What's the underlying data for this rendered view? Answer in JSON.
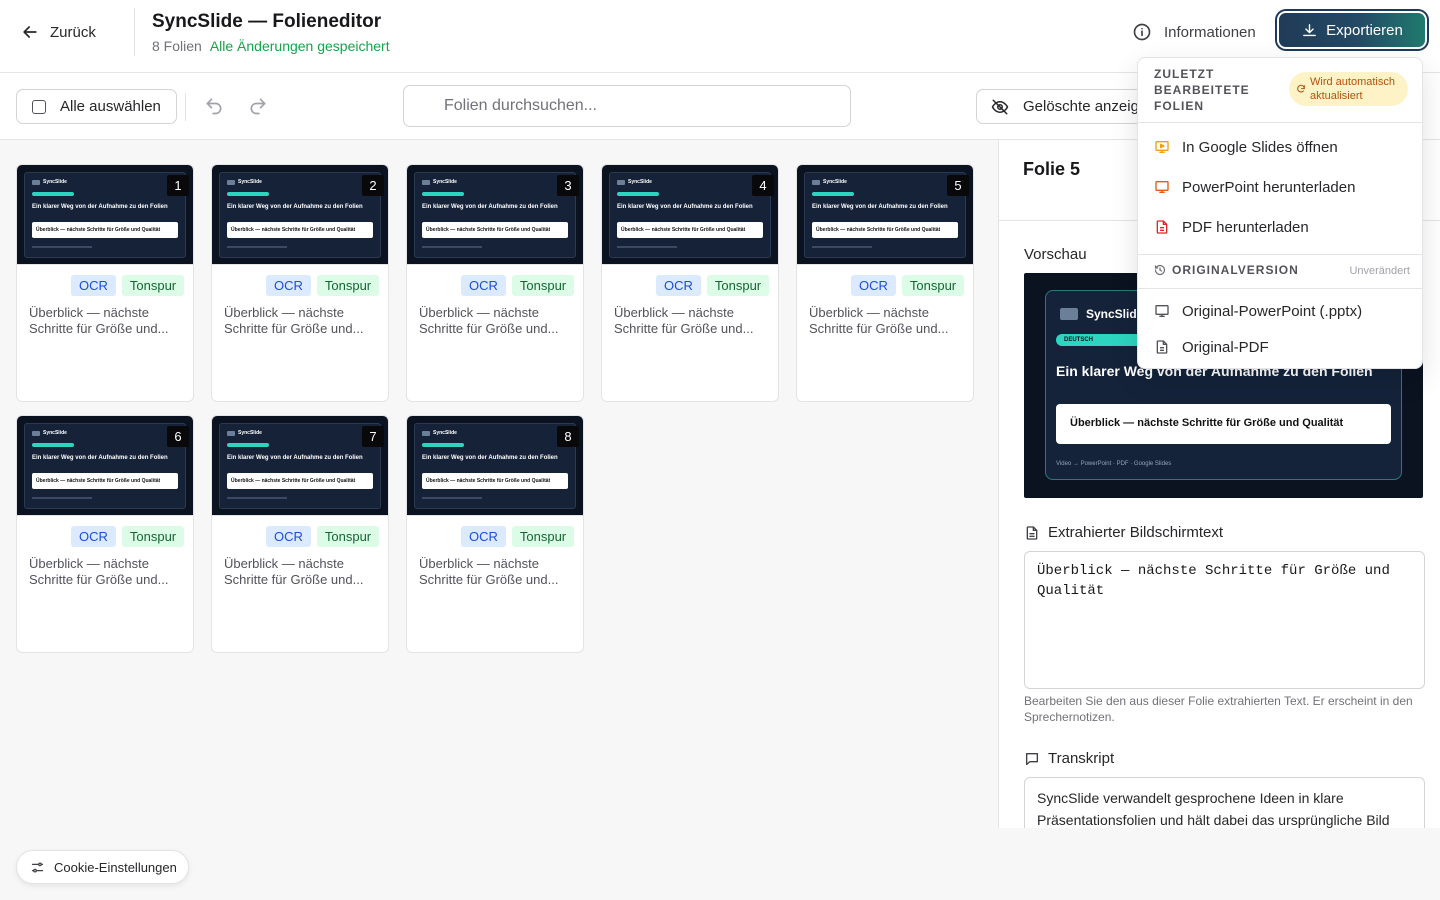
{
  "header": {
    "back_label": "Zurück",
    "title": "SyncSlide — Folieneditor",
    "slide_count": "8 Folien",
    "save_status": "Alle Änderungen gespeichert",
    "info_label": "Informationen",
    "export_label": "Exportieren"
  },
  "toolbar": {
    "select_all_label": "Alle auswählen",
    "search_placeholder": "Folien durchsuchen...",
    "deleted_label": "Gelöschte anzeigen"
  },
  "slides": [
    {
      "number": "1",
      "badge_ocr": "OCR",
      "badge_audio": "Tonspur",
      "text": "Überblick — nächste Schritte für Größe und..."
    },
    {
      "number": "2",
      "badge_ocr": "OCR",
      "badge_audio": "Tonspur",
      "text": "Überblick — nächste Schritte für Größe und..."
    },
    {
      "number": "3",
      "badge_ocr": "OCR",
      "badge_audio": "Tonspur",
      "text": "Überblick — nächste Schritte für Größe und..."
    },
    {
      "number": "4",
      "badge_ocr": "OCR",
      "badge_audio": "Tonspur",
      "text": "Überblick — nächste Schritte für Größe und..."
    },
    {
      "number": "5",
      "badge_ocr": "OCR",
      "badge_audio": "Tonspur",
      "text": "Überblick — nächste Schritte für Größe und..."
    },
    {
      "number": "6",
      "badge_ocr": "OCR",
      "badge_audio": "Tonspur",
      "text": "Überblick — nächste Schritte für Größe und..."
    },
    {
      "number": "7",
      "badge_ocr": "OCR",
      "badge_audio": "Tonspur",
      "text": "Überblick — nächste Schritte für Größe und..."
    },
    {
      "number": "8",
      "badge_ocr": "OCR",
      "badge_audio": "Tonspur",
      "text": "Überblick — nächste Schritte für Größe und..."
    }
  ],
  "thumbnail": {
    "brand": "SyncSlide",
    "headline": "Ein klarer Weg von der Aufnahme zu den Folien",
    "box_text": "Überblick — nächste Schritte für Größe und Qualität"
  },
  "panel": {
    "title": "Folie 5",
    "preview_label": "Vorschau",
    "preview": {
      "brand": "SyncSlide",
      "pill": "DEUTSCH",
      "headline": "Ein klarer Weg von der Aufnahme zu den Folien",
      "box_text": "Überblick — nächste Schritte für Größe und Qualität",
      "footer": "Video → PowerPoint · PDF · Google Slides"
    },
    "extracted_label": "Extrahierter Bildschirmtext",
    "extracted_text": "Überblick — nächste Schritte für Größe und Qualität",
    "extracted_helper": "Bearbeiten Sie den aus dieser Folie extrahierten Text. Er erscheint in den Sprechernotizen.",
    "transcript_label": "Transkript",
    "transcript_text": "SyncSlide verwandelt gesprochene Ideen in klare Präsentationsfolien und hält dabei das ursprüngliche Bild"
  },
  "export_menu": {
    "recent_heading": "ZULETZT BEARBEITETE FOLIEN",
    "auto_badge": "Wird automatisch aktualisiert",
    "google_slides": "In Google Slides öffnen",
    "powerpoint": "PowerPoint herunterladen",
    "pdf": "PDF herunterladen",
    "original_heading": "ORIGINALVERSION",
    "unchanged": "Unverändert",
    "original_pptx": "Original-PowerPoint (.pptx)",
    "original_pdf": "Original-PDF"
  },
  "cookie_label": "Cookie-Einstellungen",
  "colors": {
    "accent_green": "#16a34a",
    "export_gradient_start": "#1f3b57",
    "export_gradient_end": "#1f7a6e",
    "ocr_badge": "#dbeafe",
    "audio_badge": "#dcfce7",
    "google_slides_icon": "#f59e0b",
    "powerpoint_icon": "#ea580c",
    "pdf_icon": "#dc2626"
  }
}
